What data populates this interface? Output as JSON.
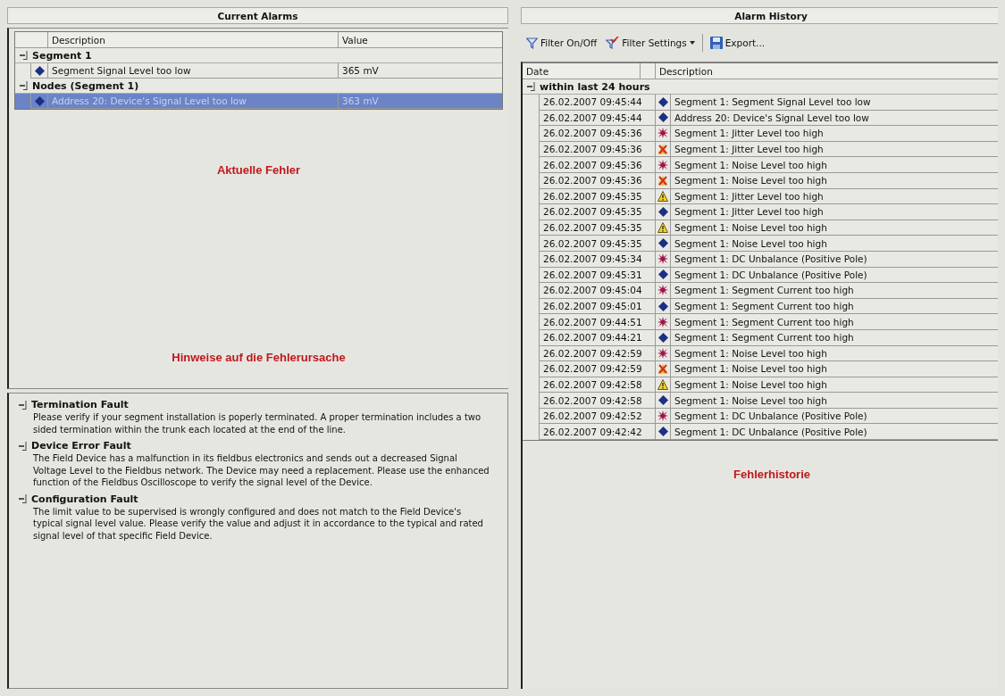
{
  "current_alarms": {
    "title": "Current Alarms",
    "columns": {
      "description": "Description",
      "value": "Value"
    },
    "groups": [
      {
        "label": "Segment 1",
        "expanded": true,
        "rows": [
          {
            "description": "Segment Signal Level too low",
            "value": "365 mV",
            "selected": false
          }
        ]
      },
      {
        "label": "Nodes (Segment 1)",
        "expanded": true,
        "rows": [
          {
            "description": "Address 20: Device's Signal Level too low",
            "value": "363 mV",
            "selected": true
          }
        ]
      }
    ],
    "annotations": [
      "Aktuelle Fehler",
      "Hinweise auf die Fehlerursache"
    ]
  },
  "hints": [
    {
      "title": "Termination Fault",
      "expanded": true,
      "text": "Please verify if your segment installation is poperly terminated. A proper termination includes a two sided termination within the trunk each located at the end of the line."
    },
    {
      "title": "Device Error Fault",
      "expanded": true,
      "text": "The Field Device has a malfunction in its fieldbus electronics and sends out a decreased Signal Voltage Level to the Fieldbus network. The Device may need a replacement. Please use the enhanced function of the Fieldbus Oscilloscope to verify the signal level of the Device."
    },
    {
      "title": "Configuration Fault",
      "expanded": true,
      "text": "The limit value to be supervised is wrongly configured and does not match to the Field Device's typical signal level value. Please verify the value and adjust it in accordance to the typical and rated signal level of that specific Field Device."
    }
  ],
  "alarm_history": {
    "title": "Alarm History",
    "toolbar": [
      {
        "kind": "filter",
        "label": "Filter On/Off"
      },
      {
        "kind": "filter-settings",
        "label": "Filter Settings",
        "has_menu": true
      },
      {
        "kind": "separator"
      },
      {
        "kind": "export",
        "label": "Export..."
      }
    ],
    "columns": {
      "date": "Date",
      "description": "Description"
    },
    "groups": [
      {
        "label": "within last 24 hours",
        "expanded": true,
        "rows": [
          {
            "date": "26.02.2007 09:45:44",
            "kind": "diamond",
            "description": "Segment 1: Segment Signal Level too low"
          },
          {
            "date": "26.02.2007 09:45:44",
            "kind": "diamond",
            "description": "Address 20: Device's Signal Level too low"
          },
          {
            "date": "26.02.2007 09:45:36",
            "kind": "burst",
            "description": "Segment 1: Jitter Level too high"
          },
          {
            "date": "26.02.2007 09:45:36",
            "kind": "cross",
            "description": "Segment 1: Jitter Level too high"
          },
          {
            "date": "26.02.2007 09:45:36",
            "kind": "burst",
            "description": "Segment 1: Noise Level too high"
          },
          {
            "date": "26.02.2007 09:45:36",
            "kind": "cross",
            "description": "Segment 1: Noise Level too high"
          },
          {
            "date": "26.02.2007 09:45:35",
            "kind": "warning",
            "description": "Segment 1: Jitter Level too high"
          },
          {
            "date": "26.02.2007 09:45:35",
            "kind": "diamond",
            "description": "Segment 1: Jitter Level too high"
          },
          {
            "date": "26.02.2007 09:45:35",
            "kind": "warning",
            "description": "Segment 1: Noise Level too high"
          },
          {
            "date": "26.02.2007 09:45:35",
            "kind": "diamond",
            "description": "Segment 1: Noise Level too high"
          },
          {
            "date": "26.02.2007 09:45:34",
            "kind": "burst",
            "description": "Segment 1: DC Unbalance (Positive Pole)"
          },
          {
            "date": "26.02.2007 09:45:31",
            "kind": "diamond",
            "description": "Segment 1: DC Unbalance (Positive Pole)"
          },
          {
            "date": "26.02.2007 09:45:04",
            "kind": "burst",
            "description": "Segment 1: Segment Current too high"
          },
          {
            "date": "26.02.2007 09:45:01",
            "kind": "diamond",
            "description": "Segment 1: Segment Current too high"
          },
          {
            "date": "26.02.2007 09:44:51",
            "kind": "burst",
            "description": "Segment 1: Segment Current too high"
          },
          {
            "date": "26.02.2007 09:44:21",
            "kind": "diamond",
            "description": "Segment 1: Segment Current too high"
          },
          {
            "date": "26.02.2007 09:42:59",
            "kind": "burst",
            "description": "Segment 1: Noise Level too high"
          },
          {
            "date": "26.02.2007 09:42:59",
            "kind": "cross",
            "description": "Segment 1: Noise Level too high"
          },
          {
            "date": "26.02.2007 09:42:58",
            "kind": "warning",
            "description": "Segment 1: Noise Level too high"
          },
          {
            "date": "26.02.2007 09:42:58",
            "kind": "diamond",
            "description": "Segment 1: Noise Level too high"
          },
          {
            "date": "26.02.2007 09:42:52",
            "kind": "burst",
            "description": "Segment 1: DC Unbalance (Positive Pole)"
          },
          {
            "date": "26.02.2007 09:42:42",
            "kind": "diamond",
            "description": "Segment 1: DC Unbalance (Positive Pole)"
          }
        ]
      }
    ],
    "annotation": "Fehlerhistorie"
  }
}
